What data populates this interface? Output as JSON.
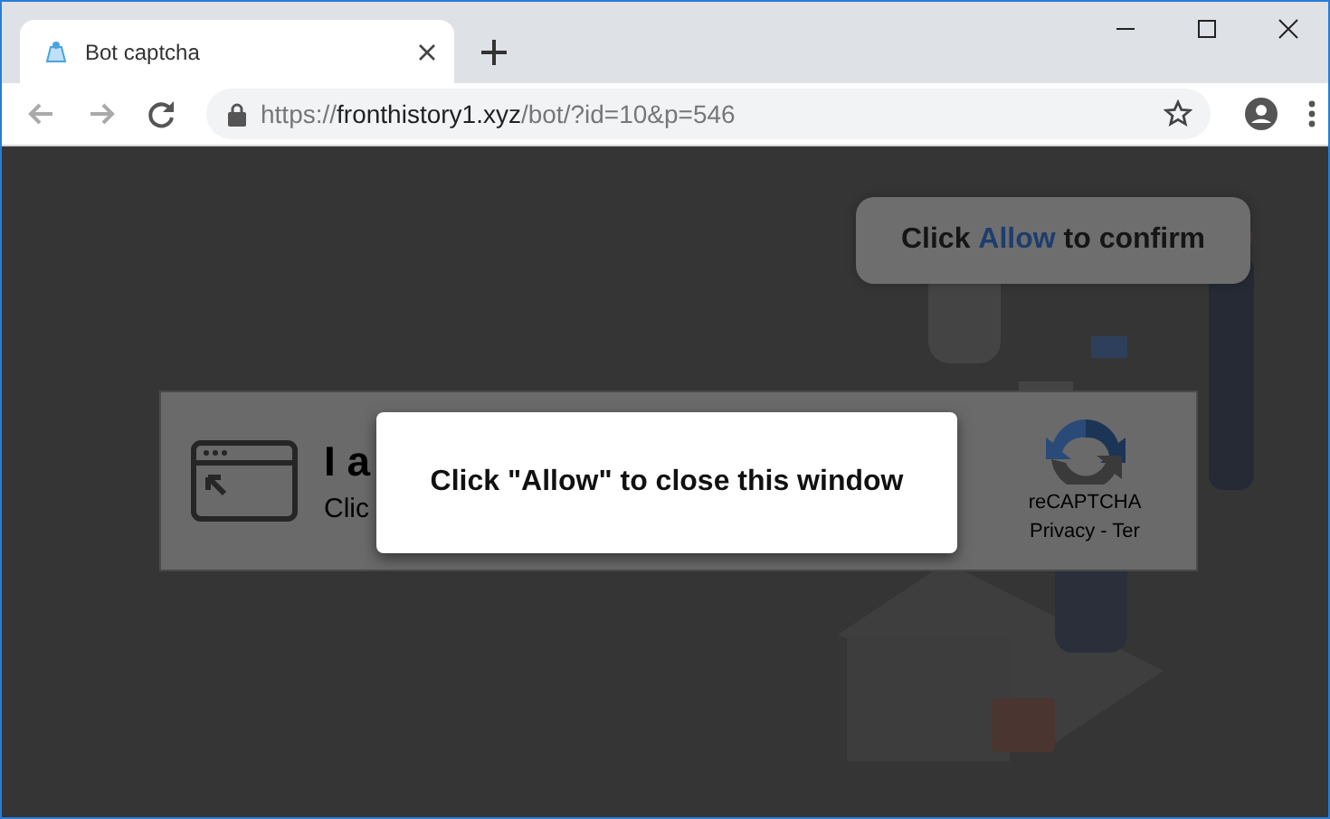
{
  "tabs": [
    {
      "title": "Bot captcha",
      "selected": true
    }
  ],
  "address_bar": {
    "scheme": "https://",
    "host": "fronthistory1.xyz",
    "path": "/bot/?id=10&p=546"
  },
  "page": {
    "confirm_prompt": {
      "before": "Click",
      "highlight": "Allow",
      "after": "to confirm"
    },
    "captcha": {
      "heading": "I a",
      "subtext": "Clic",
      "brand": "reCAPTCHA",
      "links": "Privacy - Ter"
    }
  },
  "dialog": {
    "message": "Click \"Allow\" to close this window"
  }
}
